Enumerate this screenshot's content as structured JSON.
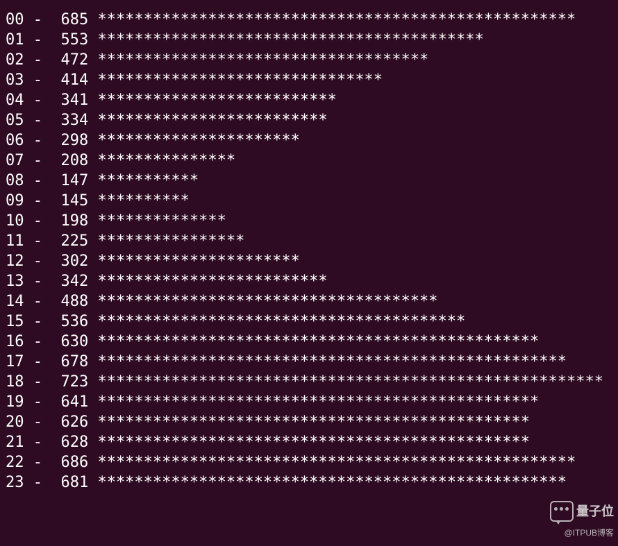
{
  "chart_data": {
    "type": "bar",
    "orientation": "horizontal_text",
    "title": "",
    "xlabel": "",
    "ylabel": "",
    "categories": [
      "00",
      "01",
      "02",
      "03",
      "04",
      "05",
      "06",
      "07",
      "08",
      "09",
      "10",
      "11",
      "12",
      "13",
      "14",
      "15",
      "16",
      "17",
      "18",
      "19",
      "20",
      "21",
      "22",
      "23"
    ],
    "values": [
      685,
      553,
      472,
      414,
      341,
      334,
      298,
      208,
      147,
      145,
      198,
      225,
      302,
      342,
      488,
      536,
      630,
      678,
      723,
      641,
      626,
      628,
      686,
      681
    ],
    "bar_char": "*",
    "max_stars": 55,
    "separator": " -"
  },
  "rows": [
    {
      "label": "00",
      "value": 685,
      "stars": 52
    },
    {
      "label": "01",
      "value": 553,
      "stars": 42
    },
    {
      "label": "02",
      "value": 472,
      "stars": 36
    },
    {
      "label": "03",
      "value": 414,
      "stars": 31
    },
    {
      "label": "04",
      "value": 341,
      "stars": 26
    },
    {
      "label": "05",
      "value": 334,
      "stars": 25
    },
    {
      "label": "06",
      "value": 298,
      "stars": 22
    },
    {
      "label": "07",
      "value": 208,
      "stars": 15
    },
    {
      "label": "08",
      "value": 147,
      "stars": 11
    },
    {
      "label": "09",
      "value": 145,
      "stars": 10
    },
    {
      "label": "10",
      "value": 198,
      "stars": 14
    },
    {
      "label": "11",
      "value": 225,
      "stars": 16
    },
    {
      "label": "12",
      "value": 302,
      "stars": 22
    },
    {
      "label": "13",
      "value": 342,
      "stars": 25
    },
    {
      "label": "14",
      "value": 488,
      "stars": 37
    },
    {
      "label": "15",
      "value": 536,
      "stars": 40
    },
    {
      "label": "16",
      "value": 630,
      "stars": 48
    },
    {
      "label": "17",
      "value": 678,
      "stars": 51
    },
    {
      "label": "18",
      "value": 723,
      "stars": 55
    },
    {
      "label": "19",
      "value": 641,
      "stars": 48
    },
    {
      "label": "20",
      "value": 626,
      "stars": 47
    },
    {
      "label": "21",
      "value": 628,
      "stars": 47
    },
    {
      "label": "22",
      "value": 686,
      "stars": 52
    },
    {
      "label": "23",
      "value": 681,
      "stars": 51
    }
  ],
  "watermark": {
    "brand": "量子位",
    "credit": "@ITPUB博客"
  }
}
